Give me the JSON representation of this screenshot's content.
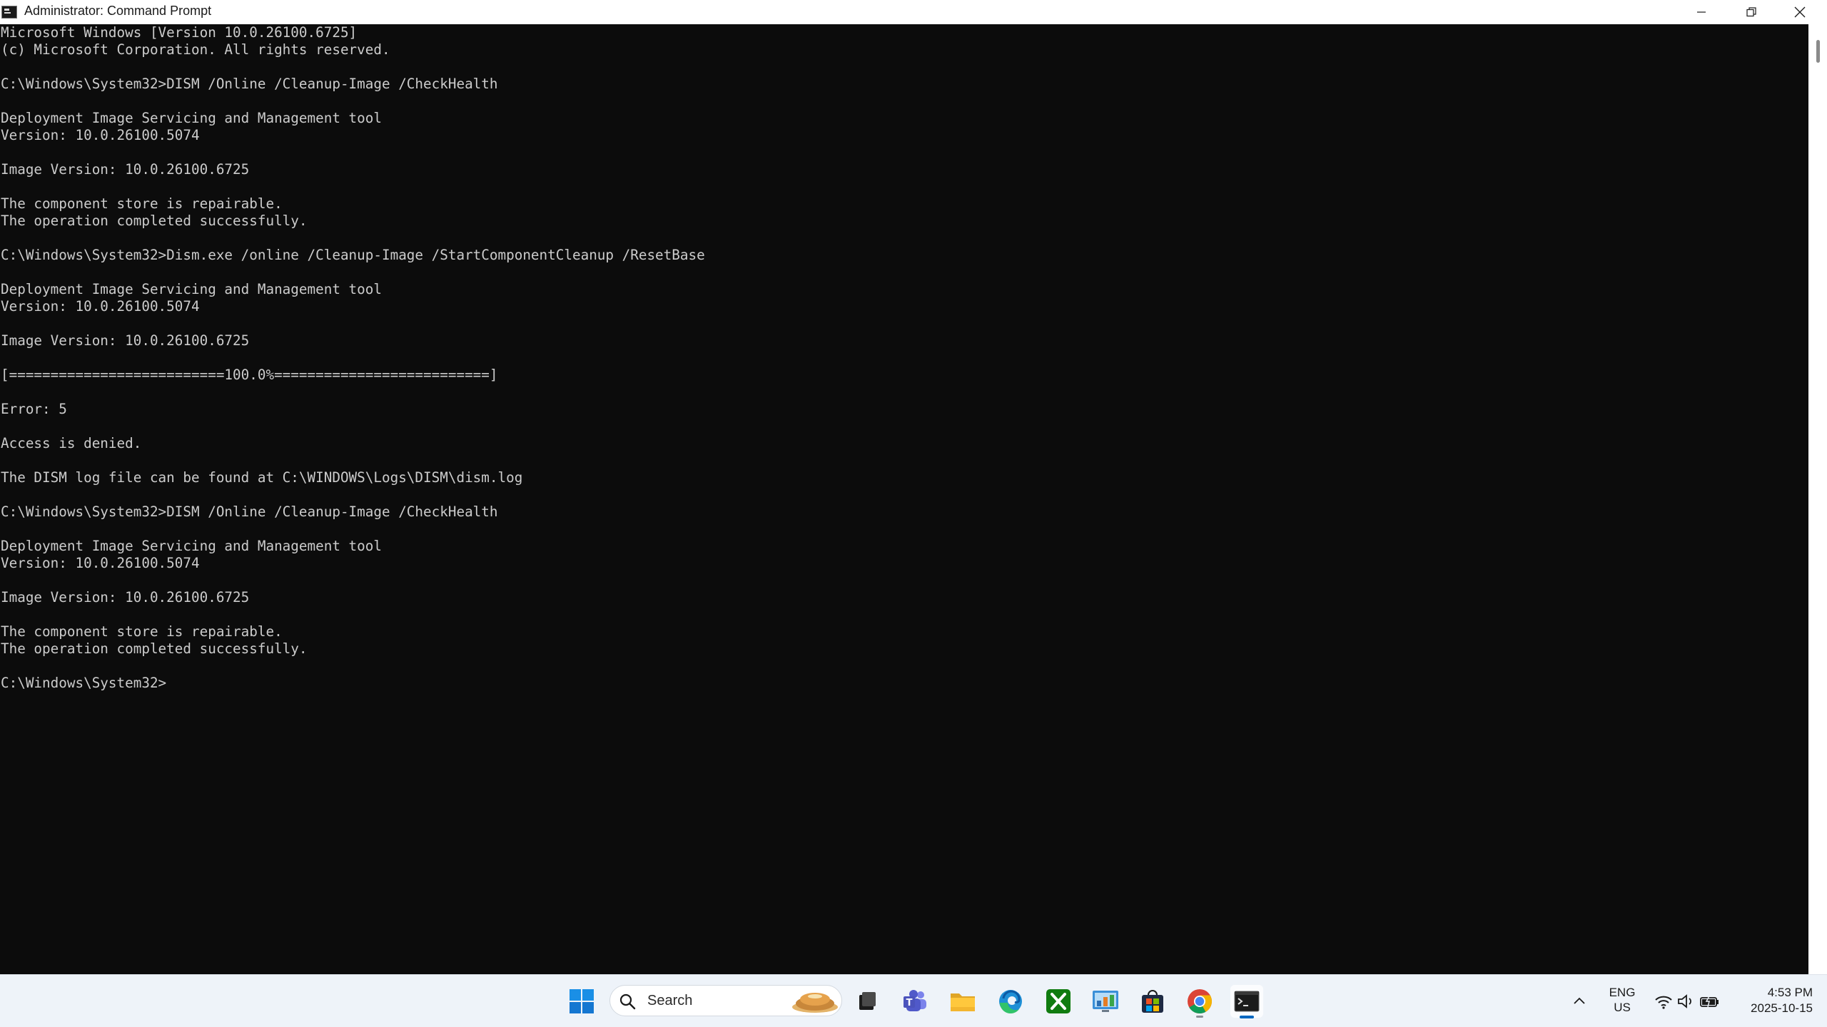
{
  "window": {
    "title": "Administrator: Command Prompt",
    "icon": "cmd-icon"
  },
  "console": {
    "lines": [
      "Microsoft Windows [Version 10.0.26100.6725]",
      "(c) Microsoft Corporation. All rights reserved.",
      "",
      "C:\\Windows\\System32>DISM /Online /Cleanup-Image /CheckHealth",
      "",
      "Deployment Image Servicing and Management tool",
      "Version: 10.0.26100.5074",
      "",
      "Image Version: 10.0.26100.6725",
      "",
      "The component store is repairable.",
      "The operation completed successfully.",
      "",
      "C:\\Windows\\System32>Dism.exe /online /Cleanup-Image /StartComponentCleanup /ResetBase",
      "",
      "Deployment Image Servicing and Management tool",
      "Version: 10.0.26100.5074",
      "",
      "Image Version: 10.0.26100.6725",
      "",
      "[==========================100.0%==========================]",
      "",
      "Error: 5",
      "",
      "Access is denied.",
      "",
      "The DISM log file can be found at C:\\WINDOWS\\Logs\\DISM\\dism.log",
      "",
      "C:\\Windows\\System32>DISM /Online /Cleanup-Image /CheckHealth",
      "",
      "Deployment Image Servicing and Management tool",
      "Version: 10.0.26100.5074",
      "",
      "Image Version: 10.0.26100.6725",
      "",
      "The component store is repairable.",
      "The operation completed successfully.",
      "",
      "C:\\Windows\\System32>"
    ]
  },
  "taskbar": {
    "search_placeholder": "Search",
    "apps": [
      "start-icon",
      "task-view-icon",
      "teams-icon",
      "file-explorer-icon",
      "edge-icon",
      "xbox-icon",
      "control-panel-icon",
      "store-icon",
      "chrome-icon",
      "command-prompt-icon"
    ],
    "tray": {
      "lang_top": "ENG",
      "lang_bottom": "US",
      "time": "4:53 PM",
      "date": "2025-10-15"
    }
  },
  "colors": {
    "console_bg": "#0c0c0c",
    "console_fg": "#cccccc",
    "accent": "#0067c0"
  }
}
